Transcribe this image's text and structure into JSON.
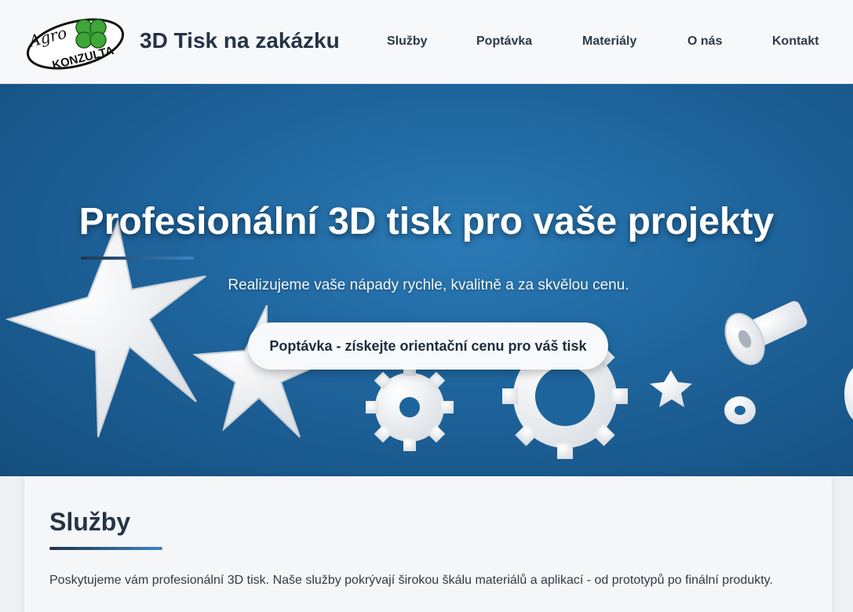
{
  "header": {
    "logo_text": "AgroKONZULTA",
    "site_title": "3D Tisk na zakázku",
    "nav": [
      "Služby",
      "Poptávka",
      "Materiály",
      "O nás",
      "Kontakt"
    ]
  },
  "hero": {
    "title": "Profesionální 3D tisk pro vaše projekty",
    "subtitle": "Realizujeme vaše nápady rychle, kvalitně a za skvělou cenu.",
    "cta_label": "Poptávka - získejte orientační cenu pro váš tisk",
    "background_color": "#1e649c"
  },
  "services": {
    "title": "Služby",
    "text": "Poskytujeme vám profesionální 3D tisk. Naše služby pokrývají širokou škálu materiálů a aplikací - od prototypů po finální produkty."
  },
  "colors": {
    "accent": "#3b85c9",
    "heading": "#243447"
  }
}
